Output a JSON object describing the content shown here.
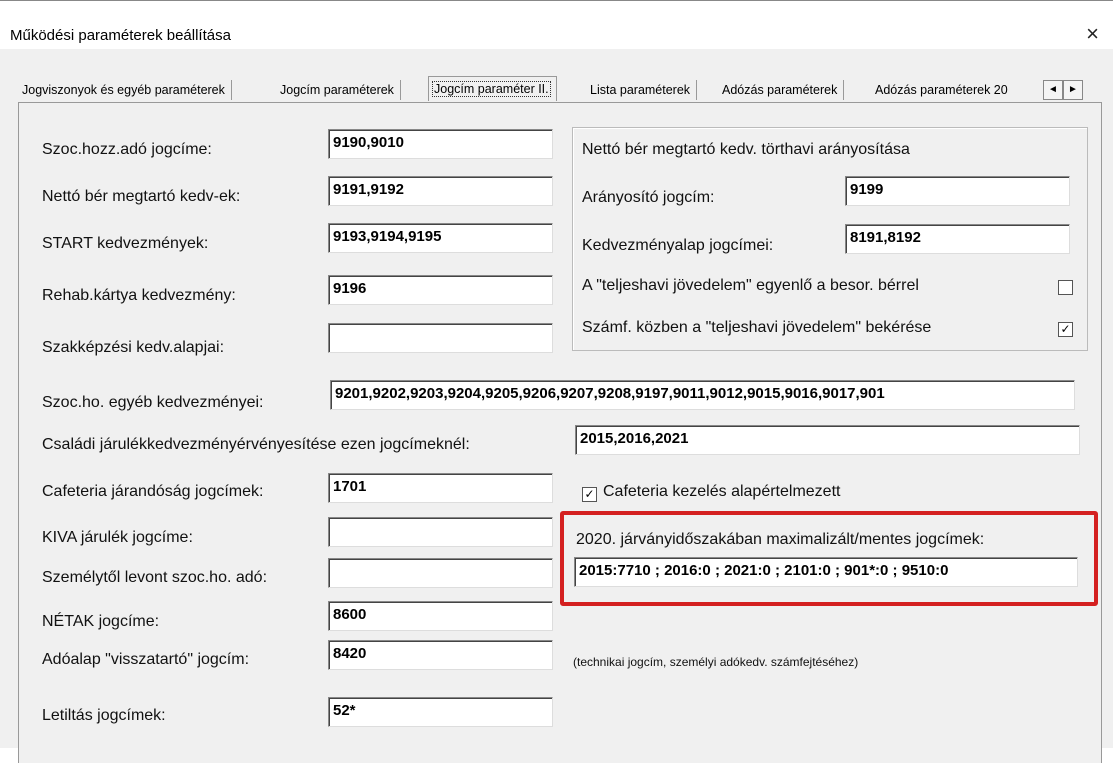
{
  "window": {
    "title": "Működési paraméterek beállítása",
    "close_glyph": "×"
  },
  "tabs": [
    {
      "label": "Jogviszonyok és egyéb paraméterek",
      "active": false
    },
    {
      "label": "Jogcím paraméterek",
      "active": false
    },
    {
      "label": "Jogcím paraméter II.",
      "active": true
    },
    {
      "label": "Lista paraméterek",
      "active": false
    },
    {
      "label": "Adózás paraméterek",
      "active": false
    },
    {
      "label": "Adózás paraméterek 20",
      "active": false
    }
  ],
  "tab_scroll": {
    "left": "◄",
    "right": "►"
  },
  "fields": {
    "szoc_hozz": {
      "label": "Szoc.hozz.adó jogcíme:",
      "value": "9190,9010"
    },
    "netto_ber": {
      "label": "Nettó bér megtartó kedv-ek:",
      "value": "9191,9192"
    },
    "start": {
      "label": "START kedvezmények:",
      "value": "9193,9194,9195"
    },
    "rehab": {
      "label": "Rehab.kártya kedvezmény:",
      "value": "9196"
    },
    "szakkepzesi": {
      "label": "Szakképzési kedv.alapjai:",
      "value": ""
    },
    "szoc_egyeb": {
      "label": "Szoc.ho. egyéb kedvezményei:",
      "value": "9201,9202,9203,9204,9205,9206,9207,9208,9197,9011,9012,9015,9016,9017,901"
    },
    "csaladi": {
      "label": "Családi járulékkedvezményérvényesítése ezen jogcímeknél:",
      "value": "2015,2016,2021"
    },
    "cafeteria": {
      "label": "Cafeteria járandóság jogcímek:",
      "value": "1701"
    },
    "kiva": {
      "label": "KIVA járulék jogcíme:",
      "value": ""
    },
    "szemelytol": {
      "label": "Személytől levont szoc.ho. adó:",
      "value": ""
    },
    "netak": {
      "label": "NÉTAK jogcíme:",
      "value": "8600"
    },
    "adoalap": {
      "label": "Adóalap \"visszatartó\" jogcím:",
      "value": "8420"
    },
    "letiltas": {
      "label": "Letiltás jogcímek:",
      "value": "52*"
    }
  },
  "group": {
    "title": "Nettó bér megtartó kedv. törthavi arányosítása",
    "aranyosito": {
      "label": "Arányosító jogcím:",
      "value": "9199"
    },
    "kedv_alap": {
      "label": "Kedvezményalap jogcímei:",
      "value": "8191,8192"
    },
    "teljeshavi_egyenlo": {
      "label": "A \"teljeshavi jövedelem\" egyenlő a besor. bérrel",
      "checked": false
    },
    "teljeshavi_bekeres": {
      "label": "Számf. közben a \"teljeshavi jövedelem\" bekérése",
      "checked": true
    }
  },
  "cafeteria_default": {
    "label": "Cafeteria kezelés alapértelmezett",
    "checked": true
  },
  "jarvany": {
    "label": "2020. járványidőszakában maximalizált/mentes jogcímek:",
    "value": "2015:7710 ; 2016:0 ; 2021:0 ; 2101:0 ; 901*:0 ; 9510:0"
  },
  "technikai_note": "(technikai jogcím, személyi adókedv. számfejtéséhez)",
  "check_glyph": "✓",
  "colors": {
    "highlight": "#d42020"
  }
}
